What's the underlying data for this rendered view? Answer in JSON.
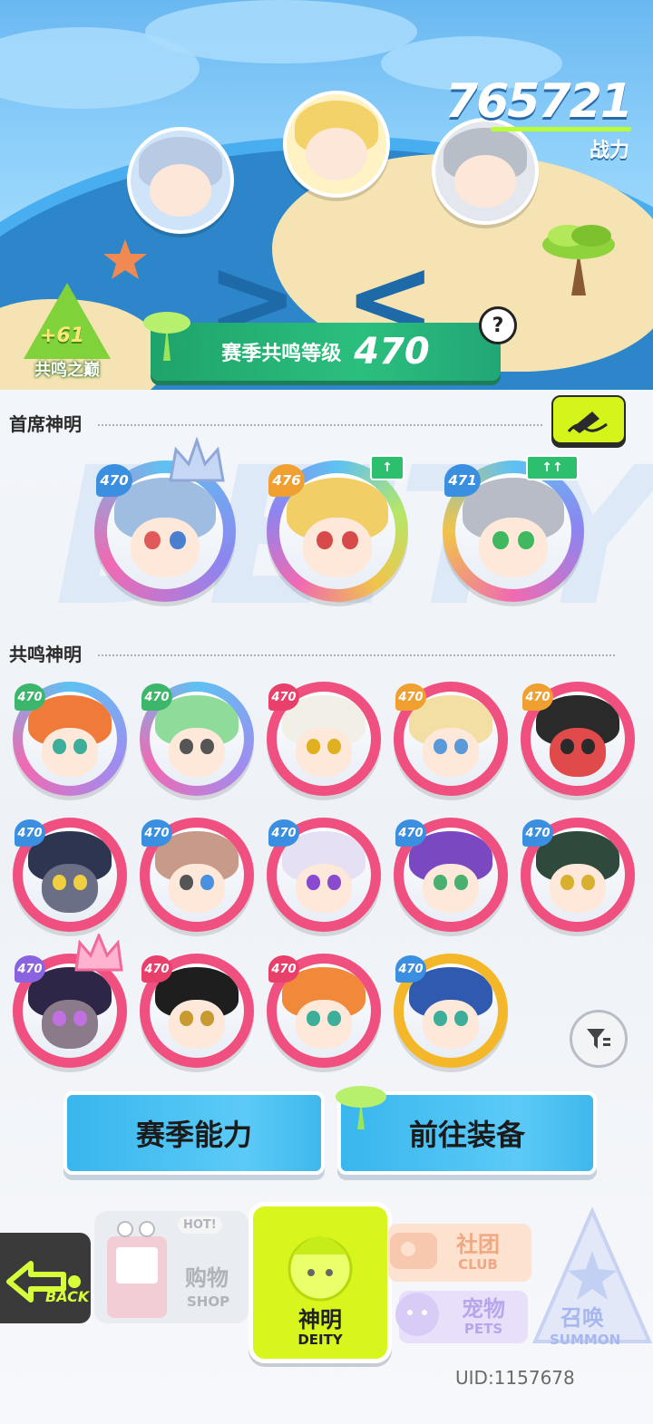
{
  "top": {
    "power_value": "765721",
    "power_label": "战力",
    "peak_badge": {
      "plus": "+61",
      "label": "共鸣之巅"
    },
    "season_level": {
      "label": "赛季共鸣等级",
      "value": "470"
    },
    "help_symbol": "?"
  },
  "watermark": "DEITY",
  "chief": {
    "title": "首席神明",
    "members": [
      {
        "level": "470",
        "up": ""
      },
      {
        "level": "476",
        "up": "↑"
      },
      {
        "level": "471",
        "up": "↑↑"
      }
    ]
  },
  "resonance": {
    "title": "共鸣神明",
    "members": [
      {
        "level": "470"
      },
      {
        "level": "470"
      },
      {
        "level": "470"
      },
      {
        "level": "470"
      },
      {
        "level": "470"
      },
      {
        "level": "470"
      },
      {
        "level": "470"
      },
      {
        "level": "470"
      },
      {
        "level": "470"
      },
      {
        "level": "470"
      },
      {
        "level": "470"
      },
      {
        "level": "470"
      },
      {
        "level": "470"
      },
      {
        "level": "470"
      }
    ]
  },
  "actions": {
    "season_ability": "赛季能力",
    "go_equip": "前往装备"
  },
  "nav": {
    "back": "BACK",
    "shop": {
      "cn": "购物",
      "en": "SHOP",
      "hot": "HOT!"
    },
    "deity": {
      "cn": "神明",
      "en": "DEITY"
    },
    "club": {
      "cn": "社团",
      "en": "CLUB"
    },
    "pets": {
      "cn": "宠物",
      "en": "PETS"
    },
    "summon": {
      "cn": "召唤",
      "en": "SUMMON"
    }
  },
  "uid": "UID:1157678",
  "colors": {
    "accent_green": "#2bbf7e",
    "accent_lime": "#d5f41a",
    "card_blue": "#5ec1f2",
    "card_pink": "#f0507f",
    "card_gold": "#f5b72a",
    "action_blue": "#38b6ee"
  }
}
